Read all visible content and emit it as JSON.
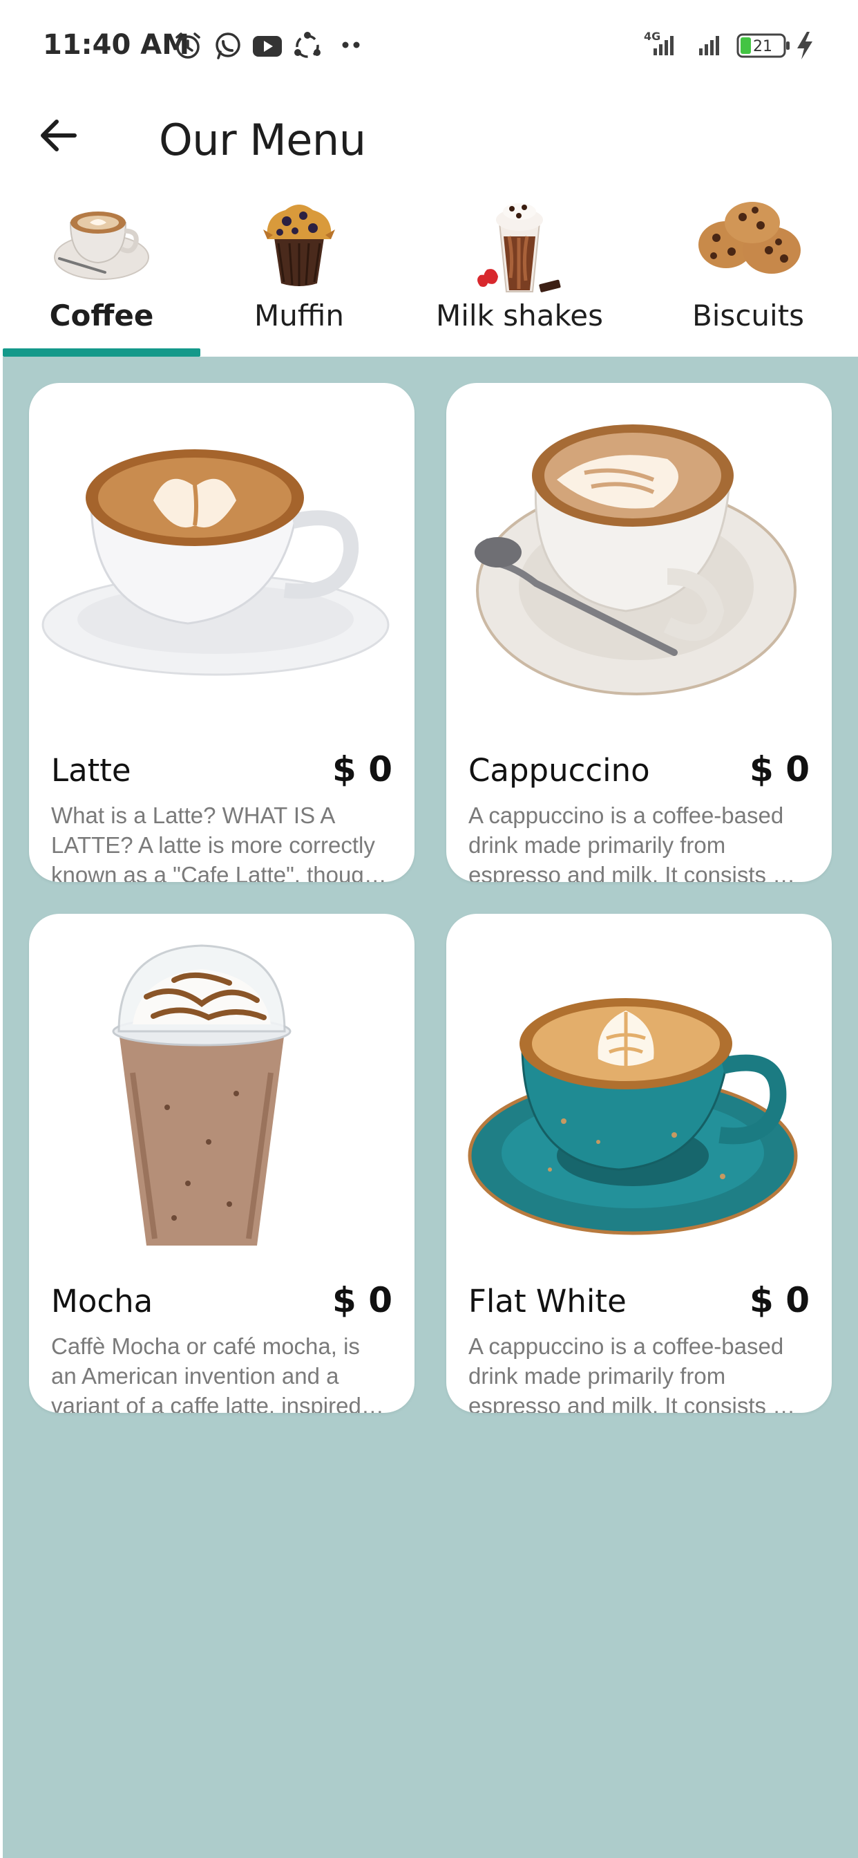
{
  "status_bar": {
    "time": "11:40 AM",
    "icons": [
      "alarm-icon",
      "whatsapp-icon",
      "youtube-icon",
      "app-icon",
      "more-dots-icon"
    ],
    "network_label": "4G",
    "battery": "21"
  },
  "header": {
    "title": "Our Menu"
  },
  "tabs": [
    {
      "label": "Coffee",
      "active": true
    },
    {
      "label": "Muffin",
      "active": false
    },
    {
      "label": "Milk shakes",
      "active": false
    },
    {
      "label": "Biscuits",
      "active": false
    }
  ],
  "products": [
    {
      "name": "Latte",
      "price": "$ 0",
      "desc_lines": [
        "What is a Latte? WHAT IS A",
        "LATTE? A latte is more correctly",
        "known as a \"Cafe Latte\", thoug…"
      ]
    },
    {
      "name": "Cappuccino",
      "price": "$ 0",
      "desc_lines": [
        "A cappuccino is a coffee-based",
        "drink made primarily from",
        "espresso and milk. It consists …"
      ]
    },
    {
      "name": "Mocha",
      "price": "$ 0",
      "desc_lines": [
        "Caffè Mocha or café mocha, is",
        "an American invention and a",
        "variant of a caffe latte, inspired…"
      ]
    },
    {
      "name": "Flat White",
      "price": "$ 0",
      "desc_lines": [
        "A cappuccino is a coffee-based",
        "drink made primarily from",
        "espresso and milk. It consists …"
      ]
    }
  ],
  "colors": {
    "accent": "#14998a",
    "content_bg": "#adcccb",
    "card_bg": "#ffffff",
    "desc_text": "#7a7a7a"
  }
}
